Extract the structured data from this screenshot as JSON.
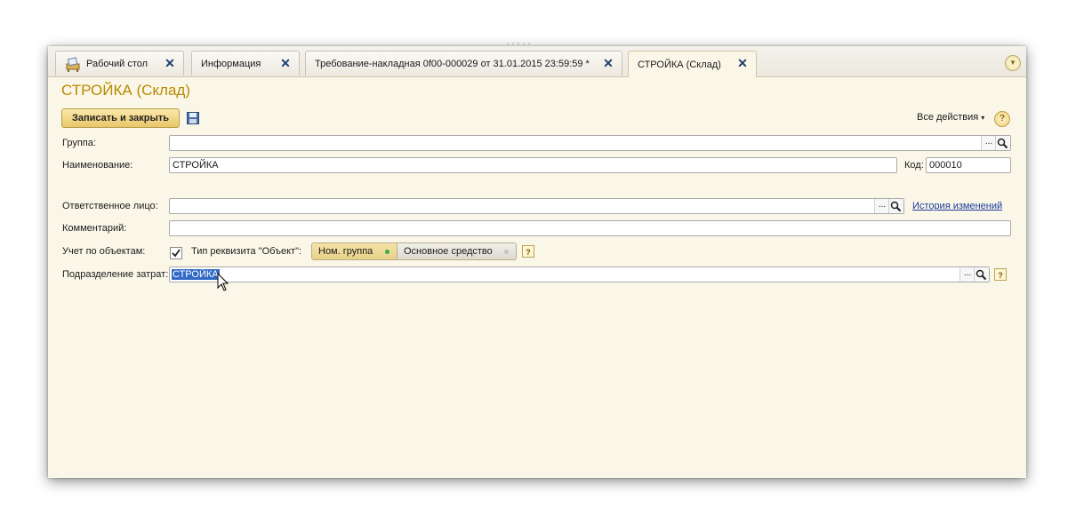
{
  "tabs": [
    {
      "label": "Рабочий стол",
      "active": false
    },
    {
      "label": "Информация",
      "active": false
    },
    {
      "label": "Требование-накладная 0f00-000029 от 31.01.2015 23:59:59 *",
      "active": false
    },
    {
      "label": "СТРОЙКА (Склад)",
      "active": true
    }
  ],
  "form": {
    "title": "СТРОЙКА (Склад)",
    "save_close_label": "Записать и закрыть",
    "all_actions_label": "Все действия",
    "help_label": "?",
    "group": {
      "label": "Группа:",
      "value": ""
    },
    "name": {
      "label": "Наименование:",
      "value": "СТРОЙКА"
    },
    "code": {
      "label": "Код:",
      "value": "000010"
    },
    "responsible": {
      "label": "Ответственное лицо:",
      "value": ""
    },
    "history_link": "История изменений",
    "comment": {
      "label": "Комментарий:",
      "value": ""
    },
    "object_accounting": {
      "label": "Учет по объектам:",
      "checked": true
    },
    "object_type": {
      "label": "Тип реквизита \"Объект\":",
      "options": [
        "Ном. группа",
        "Основное средство"
      ],
      "selected": "Ном. группа"
    },
    "cost_division": {
      "label": "Подразделение затрат:",
      "value": "СТРОЙКА"
    },
    "select_button": "...",
    "field_help": "?"
  },
  "colors": {
    "title": "#b88a00",
    "background": "#fbf7e8",
    "selection": "#316ac5",
    "link": "#1a3a9a"
  },
  "icons": [
    "desktop-icon",
    "close-icon",
    "scroll-tabs-icon",
    "save-disk-icon",
    "help-icon",
    "search-icon",
    "checkbox-checked-icon",
    "mouse-cursor-icon"
  ]
}
